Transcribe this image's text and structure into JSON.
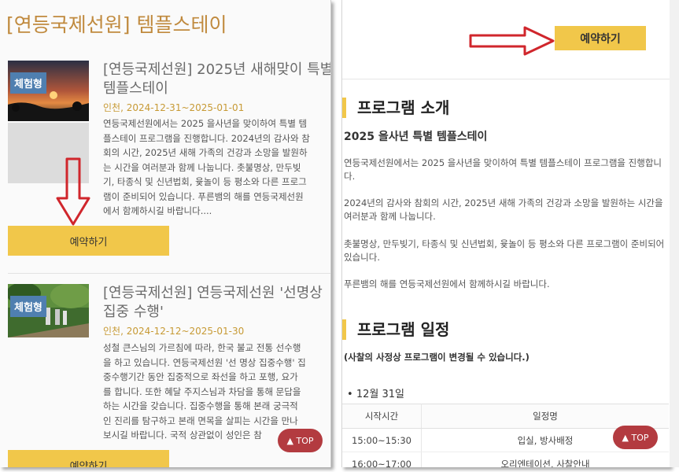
{
  "left": {
    "page_title": "[연등국제선원] 템플스테이",
    "cards": [
      {
        "badge": "체험형",
        "title": "[연등국제선원] 2025년 새해맞이 특별 템플스테이",
        "title_line1": "[연등국제선원] 2025년 새해맞이 특별",
        "title_line2": "템플스테이",
        "date": "인천, 2024-12-31~2025-01-01",
        "desc_lines": [
          "연등국제선원에서는 2025 을사년을 맞이하여 특별 템",
          "플스테이 프로그램을 진행합니다. 2024년의 감사와 참",
          "회의 시간, 2025년 새해 가족의 건강과 소망을 발원하",
          "는 시간을 여러분과 함께 나눕니다. 촛불명상, 만두빚",
          "기, 타종식 및 신년법회, 윷놀이 등 평소와 다른 프로그",
          "램이 준비되어 있습니다. 푸른뱀의 해를 연등국제선원",
          "에서 함께하시길 바랍니다...."
        ],
        "button": "예약하기"
      },
      {
        "badge": "체험형",
        "title_line1": "[연등국제선원] 연등국제선원 '선명상",
        "title_line2": "집중 수행'",
        "date": "인천, 2024-12-12~2025-01-30",
        "desc_lines": [
          "성철 큰스님의 가르침에 따라, 한국 불교 전통 선수행",
          "을 하고 있습니다. 연등국제선원 '선 명상 집중수행' 집",
          "중수행기간 동안 집중적으로 좌선을 하고 포행, 요가",
          "를 합니다. 또한 혜달 주지스님과 차담을 통해 문답을",
          "하는 시간을 갖습니다. 집중수행을 통해 본래 궁극적",
          "인 진리를 탐구하고 본래 면목을 살피는 시간을 만나",
          "보시길 바랍니다. 국적 상관없이 성인은 참"
        ],
        "button": "예약하기"
      }
    ],
    "top_button": "TOP"
  },
  "right": {
    "reserve_button": "예약하기",
    "intro_heading": "프로그램 소개",
    "intro_subtitle": "2025 을사년 특별 템플스테이",
    "paragraphs": [
      "연등국제선원에서는 2025 을사년을 맞이하여 특별 템플스테이 프로그램을 진행합니다.",
      "2024년의 감사와 참회의 시간, 2025년 새해 가족의 건강과 소망을 발원하는 시간을 여러분과 함께 나눕니다.",
      "촛불명상, 만두빚기, 타종식 및 신년법회, 윷놀이 등 평소와 다른 프로그램이 준비되어 있습니다.",
      "푸른뱀의 해를 연등국제선원에서 함께하시길 바랍니다."
    ],
    "schedule_heading": "프로그램 일정",
    "schedule_note": "(사찰의 사정상 프로그램이 변경될 수 있습니다.)",
    "date_label": "12월 31일",
    "table": {
      "headers": [
        "시작시간",
        "일정명"
      ],
      "rows": [
        [
          "15:00~15:30",
          "입실, 방사배정"
        ],
        [
          "16:00~17:00",
          "오리엔테이션, 사찰안내"
        ]
      ]
    },
    "top_button": "TOP"
  },
  "colors": {
    "accent_yellow": "#f1c74a",
    "title_gold": "#c08a3e",
    "badge_blue": "#4f7fb0",
    "top_red": "#b33b40",
    "arrow_red": "#d0262c"
  },
  "icons": [
    "up-triangle-icon",
    "down-arrow-icon",
    "right-arrow-icon"
  ]
}
